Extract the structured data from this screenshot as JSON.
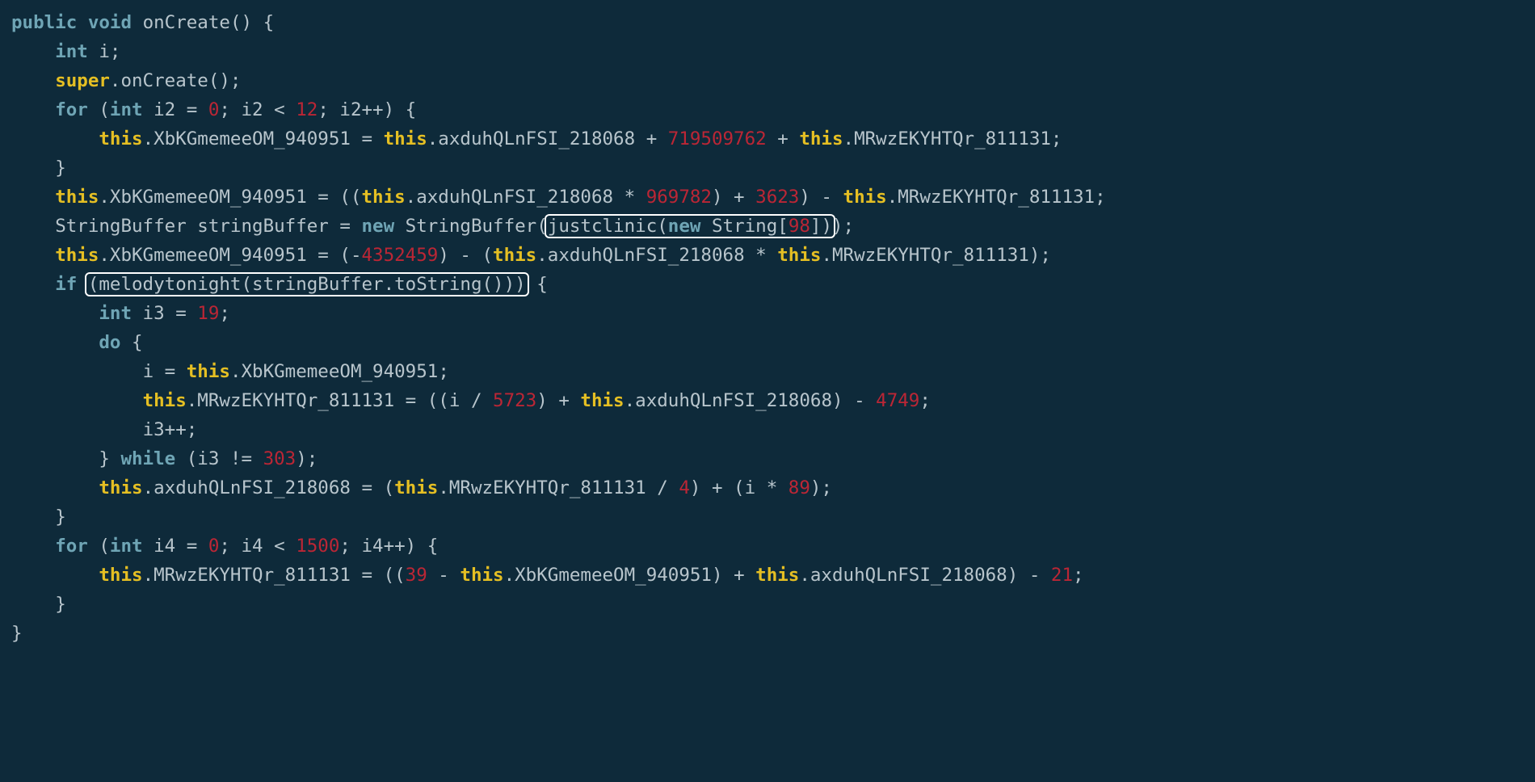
{
  "code": {
    "line1": {
      "kw_public": "public",
      "kw_void": "void",
      "fn": "onCreate",
      "paren": "() {"
    },
    "line2": {
      "kw_int": "int",
      "var": "i",
      "semi": ";"
    },
    "line3": {
      "kw_super": "super",
      "call": ".onCreate();"
    },
    "line4": {
      "kw_for": "for",
      "open": " (",
      "kw_int": "int",
      "var": " i2 = ",
      "n0": "0",
      "mid": "; i2 < ",
      "n12": "12",
      "post": "; i2++) {"
    },
    "line5": {
      "kw_this1": "this",
      "a": ".XbKGmemeeOM_940951 = ",
      "kw_this2": "this",
      "b": ".axduhQLnFSI_218068 + ",
      "n": "719509762",
      "c": " + ",
      "kw_this3": "this",
      "d": ".MRwzEKYHTQr_811131;"
    },
    "line6": {
      "close": "}"
    },
    "line7": {
      "kw_this1": "this",
      "a": ".XbKGmemeeOM_940951 = ((",
      "kw_this2": "this",
      "b": ".axduhQLnFSI_218068 * ",
      "n1": "969782",
      "c": ") + ",
      "n2": "3623",
      "d": ") - ",
      "kw_this3": "this",
      "e": ".MRwzEKYHTQr_811131;"
    },
    "line8": {
      "a": "StringBuffer stringBuffer = ",
      "kw_new1": "new",
      "b": " StringBuffer(",
      "box_pre": "justclinic(",
      "kw_new2": "new",
      "box_mid": " String[",
      "n": "98",
      "box_post": "])",
      "c": ");"
    },
    "line9": {
      "kw_this1": "this",
      "a": ".XbKGmemeeOM_940951 = (",
      "minus": "-",
      "n1": "4352459",
      "b": ") - (",
      "kw_this2": "this",
      "c": ".axduhQLnFSI_218068 * ",
      "kw_this3": "this",
      "d": ".MRwzEKYHTQr_811131);"
    },
    "line10": {
      "kw_if": "if",
      "sp": " ",
      "box": "(melodytonight(stringBuffer.toString()))",
      "post": " {"
    },
    "line11": {
      "kw_int": "int",
      "a": " i3 = ",
      "n": "19",
      "semi": ";"
    },
    "line12": {
      "kw_do": "do",
      "post": " {"
    },
    "line13": {
      "a": "i = ",
      "kw_this": "this",
      "b": ".XbKGmemeeOM_940951;"
    },
    "line14": {
      "kw_this1": "this",
      "a": ".MRwzEKYHTQr_811131 = ((i / ",
      "n1": "5723",
      "b": ") + ",
      "kw_this2": "this",
      "c": ".axduhQLnFSI_218068) - ",
      "n2": "4749",
      "semi": ";"
    },
    "line15": {
      "a": "i3++;"
    },
    "line16": {
      "a": "} ",
      "kw_while": "while",
      "b": " (i3 != ",
      "n": "303",
      "c": ");"
    },
    "line17": {
      "kw_this1": "this",
      "a": ".axduhQLnFSI_218068 = (",
      "kw_this2": "this",
      "b": ".MRwzEKYHTQr_811131 / ",
      "n1": "4",
      "c": ") + (i * ",
      "n2": "89",
      "d": ");"
    },
    "line18": {
      "close": "}"
    },
    "line19": {
      "kw_for": "for",
      "open": " (",
      "kw_int": "int",
      "var": " i4 = ",
      "n0": "0",
      "mid": "; i4 < ",
      "n1500": "1500",
      "post": "; i4++) {"
    },
    "line20": {
      "kw_this1": "this",
      "a": ".MRwzEKYHTQr_811131 = ((",
      "n1": "39",
      "b": " - ",
      "kw_this2": "this",
      "c": ".XbKGmemeeOM_940951) + ",
      "kw_this3": "this",
      "d": ".axduhQLnFSI_218068) - ",
      "n2": "21",
      "semi": ";"
    },
    "line21": {
      "close": "}"
    },
    "line22": {
      "close": "}"
    }
  }
}
